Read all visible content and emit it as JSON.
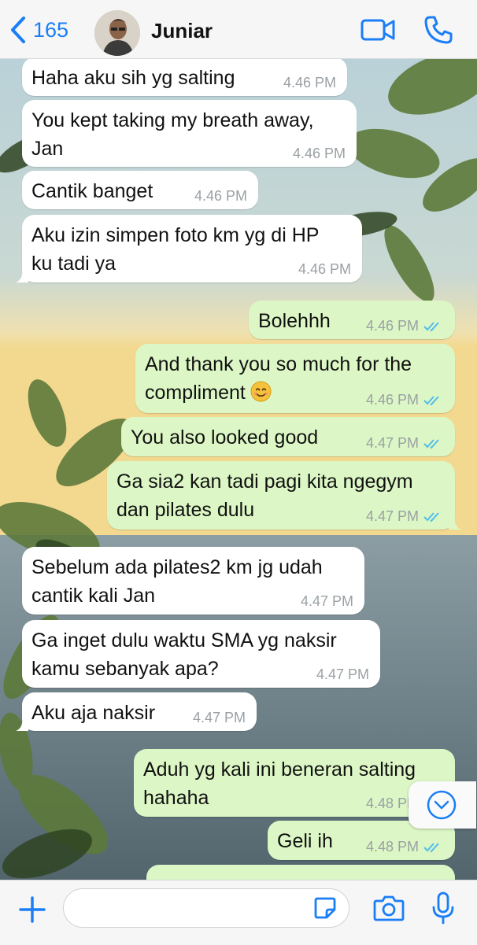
{
  "header": {
    "back_count": "165",
    "contact_name": "Juniar"
  },
  "colors": {
    "accent": "#1a7ef6",
    "incoming_bubble": "#ffffff",
    "outgoing_bubble": "#dcf7c5",
    "read_ticks": "#53bdeb",
    "timestamp": "#9aa0a4"
  },
  "icons": {
    "back": "chevron-left-icon",
    "video": "video-camera-icon",
    "call": "phone-icon",
    "scroll": "chevron-down-circle-icon",
    "attach": "plus-icon",
    "sticker": "sticker-icon",
    "camera": "camera-icon",
    "mic": "microphone-icon"
  },
  "messages": [
    {
      "dir": "in",
      "text": "Haha aku sih yg salting",
      "time": "4.46 PM"
    },
    {
      "dir": "in",
      "text": "You kept taking my breath away,\nJan",
      "time": "4.46 PM"
    },
    {
      "dir": "in",
      "text": "Cantik banget",
      "time": "4.46 PM"
    },
    {
      "dir": "in",
      "text": "Aku izin simpen foto km yg di HP\nku tadi ya",
      "time": "4.46 PM"
    },
    {
      "dir": "out",
      "text": "Bolehhh",
      "time": "4.46 PM",
      "status": "read"
    },
    {
      "dir": "out",
      "text": "And thank you so much for the\ncompliment",
      "emoji": "smiling-face",
      "time": "4.46 PM",
      "status": "read"
    },
    {
      "dir": "out",
      "text": "You also looked good",
      "time": "4.47 PM",
      "status": "read"
    },
    {
      "dir": "out",
      "text": "Ga sia2 kan tadi pagi kita ngegym\ndan pilates dulu",
      "time": "4.47 PM",
      "status": "read"
    },
    {
      "dir": "in",
      "text": "Sebelum ada pilates2 km jg udah\ncantik kali Jan",
      "time": "4.47 PM"
    },
    {
      "dir": "in",
      "text": "Ga inget dulu waktu SMA yg naksir\nkamu sebanyak apa?",
      "time": "4.47 PM"
    },
    {
      "dir": "in",
      "text": "Aku aja naksir",
      "time": "4.47 PM"
    },
    {
      "dir": "out",
      "text": "Aduh yg kali ini beneran salting\nhahaha",
      "time": "4.48 PM",
      "status": "read"
    },
    {
      "dir": "out",
      "text": "Geli ih",
      "time": "4.48 PM",
      "status": "read"
    }
  ],
  "composer": {
    "value": "",
    "placeholder": ""
  }
}
